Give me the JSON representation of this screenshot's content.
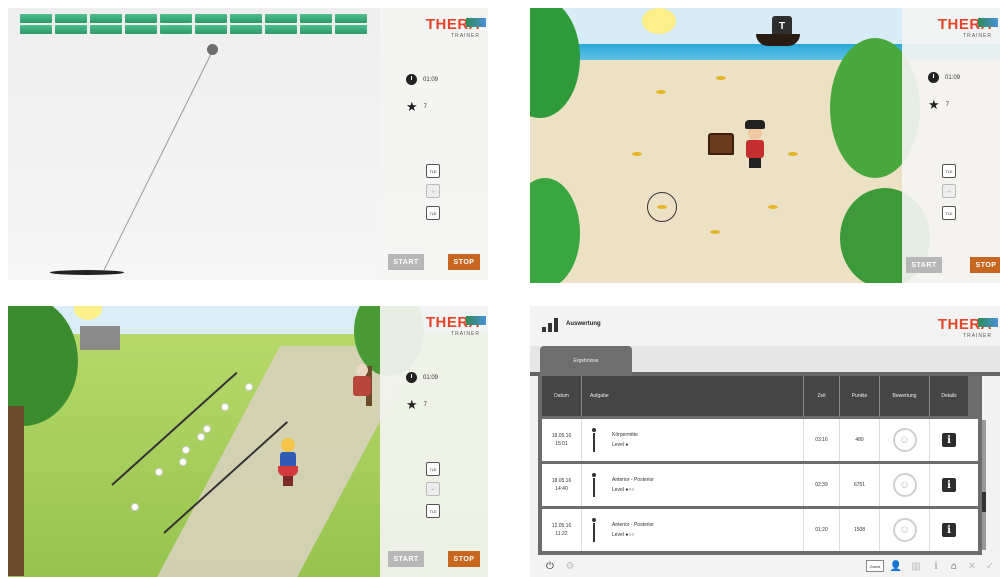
{
  "brand": {
    "name": "THERA",
    "sub": "TRAINER",
    "accent": "#e3442a"
  },
  "sidebar": {
    "time": "01:09",
    "score": "7",
    "control_label": "TLE",
    "start_label": "START",
    "stop_label": "STOP",
    "start_color": "#b7b7b7",
    "stop_color": "#c7661f"
  },
  "ship": {
    "flag": "T"
  },
  "evaluation": {
    "title": "Auswertung",
    "tab": "Ergebnisse",
    "columns": [
      "Datum",
      "Aufgabe",
      "Zeit",
      "Punkte",
      "Bewertung",
      "Details"
    ],
    "rows": [
      {
        "date": "18.05.16",
        "time": "15:01",
        "task": "Körpermitte",
        "level": "Level ●",
        "duration": "03:16",
        "points": "480"
      },
      {
        "date": "18.05.16",
        "time": "14:40",
        "task": "Anterior - Posterior",
        "level": "Level ●○○",
        "duration": "02:39",
        "points": "6751"
      },
      {
        "date": "12.05.16",
        "time": "11:22",
        "task": "Anterior - Posterior",
        "level": "Level ●○○",
        "duration": "01:20",
        "points": "1508"
      }
    ],
    "footer": {
      "guest": "Guest"
    }
  }
}
